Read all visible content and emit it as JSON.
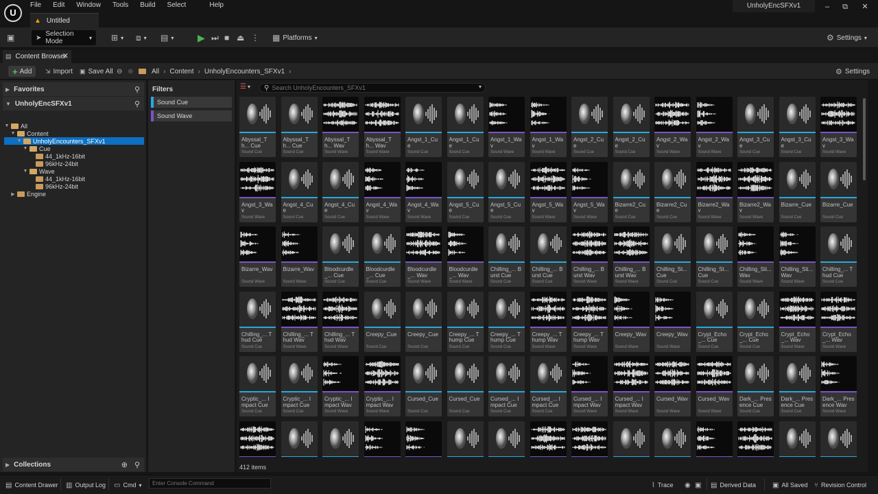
{
  "app": {
    "project_name": "UnholyEncSFXv1",
    "level_tab": "Untitled",
    "menu": [
      "File",
      "Edit",
      "Window",
      "Tools",
      "Build",
      "Select",
      "Help"
    ],
    "win_min": "–",
    "win_max": "⧉",
    "win_close": "✕"
  },
  "toolbar": {
    "selection_mode": "Selection Mode",
    "platforms": "Platforms",
    "settings": "Settings"
  },
  "content_browser": {
    "tab_label": "Content Browser",
    "close": "✕",
    "add": "Add",
    "import": "Import",
    "save_all": "Save All",
    "breadcrumb": [
      "All",
      "Content",
      "UnholyEncounters_SFXv1"
    ],
    "settings": "Settings"
  },
  "left_panel": {
    "favorites": "Favorites",
    "project_root": "UnholyEncSFXv1",
    "tree": [
      {
        "label": "All",
        "depth": 0,
        "expanded": true,
        "selected": false
      },
      {
        "label": "Content",
        "depth": 1,
        "expanded": true,
        "selected": false
      },
      {
        "label": "UnholyEncounters_SFXv1",
        "depth": 2,
        "expanded": true,
        "selected": true
      },
      {
        "label": "Cue",
        "depth": 3,
        "expanded": true,
        "selected": false
      },
      {
        "label": "44_1kHz-16bit",
        "depth": 4,
        "expanded": false,
        "selected": false
      },
      {
        "label": "96kHz-24bit",
        "depth": 4,
        "expanded": false,
        "selected": false
      },
      {
        "label": "Wave",
        "depth": 3,
        "expanded": true,
        "selected": false
      },
      {
        "label": "44_1kHz-16bit",
        "depth": 4,
        "expanded": false,
        "selected": false
      },
      {
        "label": "96kHz-24bit",
        "depth": 4,
        "expanded": false,
        "selected": false
      },
      {
        "label": "Engine",
        "depth": 1,
        "expanded": false,
        "selected": false
      }
    ],
    "collections": "Collections"
  },
  "filters": {
    "title": "Filters",
    "items": [
      {
        "label": "Sound Cue",
        "color": "#29a8e0"
      },
      {
        "label": "Sound Wave",
        "color": "#7c54c8"
      }
    ]
  },
  "assets": {
    "search_placeholder": "Search UnholyEncounters_SFXv1",
    "item_count": "412 items",
    "cue_color": "#29a8e0",
    "wave_color": "#7c54c8",
    "items": [
      {
        "name": "Abyssal_Th... Cue",
        "type": "Sound Cue"
      },
      {
        "name": "Abyssal_Th... Cue",
        "type": "Sound Cue"
      },
      {
        "name": "Abyssal_Th... Wav",
        "type": "Sound Wave"
      },
      {
        "name": "Abyssal_Th... Wav",
        "type": "Sound Wave"
      },
      {
        "name": "Angst_1_Cue",
        "type": "Sound Cue"
      },
      {
        "name": "Angst_1_Cue",
        "type": "Sound Cue"
      },
      {
        "name": "Angst_1_Wav",
        "type": "Sound Wave"
      },
      {
        "name": "Angst_1_Wav",
        "type": "Sound Wave"
      },
      {
        "name": "Angst_2_Cue",
        "type": "Sound Cue"
      },
      {
        "name": "Angst_2_Cue",
        "type": "Sound Cue"
      },
      {
        "name": "Angst_2_Wav",
        "type": "Sound Wave"
      },
      {
        "name": "Angst_2_Wav",
        "type": "Sound Wave"
      },
      {
        "name": "Angst_3_Cue",
        "type": "Sound Cue"
      },
      {
        "name": "Angst_3_Cue",
        "type": "Sound Cue"
      },
      {
        "name": "Angst_3_Wav",
        "type": "Sound Wave"
      },
      {
        "name": "Angst_3_Wav",
        "type": "Sound Wave"
      },
      {
        "name": "Angst_4_Cue",
        "type": "Sound Cue"
      },
      {
        "name": "Angst_4_Cue",
        "type": "Sound Cue"
      },
      {
        "name": "Angst_4_Wav",
        "type": "Sound Wave"
      },
      {
        "name": "Angst_4_Wav",
        "type": "Sound Wave"
      },
      {
        "name": "Angst_5_Cue",
        "type": "Sound Cue"
      },
      {
        "name": "Angst_5_Cue",
        "type": "Sound Cue"
      },
      {
        "name": "Angst_5_Wav",
        "type": "Sound Wave"
      },
      {
        "name": "Angst_5_Wav",
        "type": "Sound Wave"
      },
      {
        "name": "Bizarre2_Cue",
        "type": "Sound Cue"
      },
      {
        "name": "Bizarre2_Cue",
        "type": "Sound Cue"
      },
      {
        "name": "Bizarre2_Wav",
        "type": "Sound Wave"
      },
      {
        "name": "Bizarre2_Wav",
        "type": "Sound Wave"
      },
      {
        "name": "Bizarre_Cue",
        "type": "Sound Cue"
      },
      {
        "name": "Bizarre_Cue",
        "type": "Sound Cue"
      },
      {
        "name": "Bizarre_Wav",
        "type": "Sound Wave"
      },
      {
        "name": "Bizarre_Wav",
        "type": "Sound Wave"
      },
      {
        "name": "Bloodcurdle_... Cue",
        "type": "Sound Cue"
      },
      {
        "name": "Bloodcurdle_... Cue",
        "type": "Sound Cue"
      },
      {
        "name": "Bloodcurdle_... Wav",
        "type": "Sound Wave"
      },
      {
        "name": "Bloodcurdle_... Wav",
        "type": "Sound Wave"
      },
      {
        "name": "Chilling_... Burst Cue",
        "type": "Sound Cue"
      },
      {
        "name": "Chilling_... Burst Cue",
        "type": "Sound Cue"
      },
      {
        "name": "Chilling_... Burst Wav",
        "type": "Sound Wave"
      },
      {
        "name": "Chilling_... Burst Wav",
        "type": "Sound Wave"
      },
      {
        "name": "Chilling_St... Cue",
        "type": "Sound Cue"
      },
      {
        "name": "Chilling_St... Cue",
        "type": "Sound Cue"
      },
      {
        "name": "Chilling_Sti... Wav",
        "type": "Sound Wave"
      },
      {
        "name": "Chilling_Sti... Wav",
        "type": "Sound Wave"
      },
      {
        "name": "Chilling_... Thud Cue",
        "type": "Sound Cue"
      },
      {
        "name": "Chilling_... Thud Cue",
        "type": "Sound Cue"
      },
      {
        "name": "Chilling_... Thud Wav",
        "type": "Sound Wave"
      },
      {
        "name": "Chilling_... Thud Wav",
        "type": "Sound Wave"
      },
      {
        "name": "Creepy_Cue",
        "type": "Sound Cue"
      },
      {
        "name": "Creepy_Cue",
        "type": "Sound Cue"
      },
      {
        "name": "Creepy_... Thump Cue",
        "type": "Sound Cue"
      },
      {
        "name": "Creepy_... Thump Cue",
        "type": "Sound Cue"
      },
      {
        "name": "Creepy_... Thump Wav",
        "type": "Sound Wave"
      },
      {
        "name": "Creepy_... Thump Wav",
        "type": "Sound Wave"
      },
      {
        "name": "Creepy_Wav",
        "type": "Sound Wave"
      },
      {
        "name": "Creepy_Wav",
        "type": "Sound Wave"
      },
      {
        "name": "Crypt_Echo_... Cue",
        "type": "Sound Cue"
      },
      {
        "name": "Crypt_Echo_... Cue",
        "type": "Sound Cue"
      },
      {
        "name": "Crypt_Echo_... Wav",
        "type": "Sound Wave"
      },
      {
        "name": "Crypt_Echo_... Wav",
        "type": "Sound Wave"
      },
      {
        "name": "Cryptic_... Impact Cue",
        "type": "Sound Cue"
      },
      {
        "name": "Cryptic_... Impact Cue",
        "type": "Sound Cue"
      },
      {
        "name": "Cryptic_... Impact Wav",
        "type": "Sound Wave"
      },
      {
        "name": "Cryptic_... Impact Wav",
        "type": "Sound Wave"
      },
      {
        "name": "Cursed_Cue",
        "type": "Sound Cue"
      },
      {
        "name": "Cursed_Cue",
        "type": "Sound Cue"
      },
      {
        "name": "Cursed_... Impact Cue",
        "type": "Sound Cue"
      },
      {
        "name": "Cursed_... Impact Cue",
        "type": "Sound Cue"
      },
      {
        "name": "Cursed_... Impact Wav",
        "type": "Sound Wave"
      },
      {
        "name": "Cursed_... Impact Wav",
        "type": "Sound Wave"
      },
      {
        "name": "Cursed_Wav",
        "type": "Sound Wave"
      },
      {
        "name": "Cursed_Wav",
        "type": "Sound Wave"
      },
      {
        "name": "Dark_... Presence Cue",
        "type": "Sound Cue"
      },
      {
        "name": "Dark_... Presence Cue",
        "type": "Sound Cue"
      },
      {
        "name": "Dark_... Presence Wav",
        "type": "Sound Wave"
      },
      {
        "name": "",
        "type": "Sound Wave"
      },
      {
        "name": "",
        "type": "Sound Cue"
      },
      {
        "name": "",
        "type": "Sound Cue"
      },
      {
        "name": "",
        "type": "Sound Wave"
      },
      {
        "name": "",
        "type": "Sound Wave"
      },
      {
        "name": "",
        "type": "Sound Cue"
      },
      {
        "name": "",
        "type": "Sound Cue"
      },
      {
        "name": "",
        "type": "Sound Wave"
      },
      {
        "name": "",
        "type": "Sound Wave"
      },
      {
        "name": "",
        "type": "Sound Cue"
      },
      {
        "name": "",
        "type": "Sound Cue"
      },
      {
        "name": "",
        "type": "Sound Wave"
      },
      {
        "name": "",
        "type": "Sound Wave"
      },
      {
        "name": "",
        "type": "Sound Cue"
      },
      {
        "name": "",
        "type": "Sound Cue"
      }
    ]
  },
  "statusbar": {
    "content_drawer": "Content Drawer",
    "output_log": "Output Log",
    "cmd": "Cmd",
    "console_placeholder": "Enter Console Command",
    "trace": "Trace",
    "derived_data": "Derived Data",
    "all_saved": "All Saved",
    "revision_control": "Revision Control"
  }
}
